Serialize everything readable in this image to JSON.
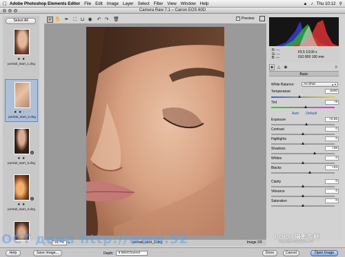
{
  "menubar": {
    "apple": "",
    "app_name": "Adobe Photoshop Elements Editor",
    "items": [
      "File",
      "Edit",
      "Image",
      "Layer",
      "Select",
      "Filter",
      "View",
      "Window",
      "Help"
    ],
    "clock": "Thu 10:12"
  },
  "window": {
    "title": "Camera Raw 7.1  –  Canon EOS 60D"
  },
  "filmstrip": {
    "select_all": "Select All",
    "items": [
      {
        "stars": "★ ★",
        "file": "portrait_start_1.dng",
        "selected": false
      },
      {
        "stars": "★ ★ · · ·",
        "file": "portrait_start_2.dng",
        "selected": true
      },
      {
        "stars": "★ ★",
        "file": "portrait_start_3.dng",
        "selected": false
      },
      {
        "stars": "★ ★",
        "file": "portrait_start_4.dng",
        "selected": false
      }
    ]
  },
  "toolbar": {
    "tools": [
      "zoom-tool",
      "hand-tool",
      "white-balance-tool",
      "crop-tool",
      "straighten-tool",
      "red-eye-tool",
      "rotate-left-tool",
      "rotate-right-tool",
      "trash-tool"
    ],
    "preview_label": "Preview",
    "preview_checked": "✓"
  },
  "status": {
    "zoom": "18.7%",
    "filename": "portrait_start_2.dng",
    "nav": "Image 2/5"
  },
  "readout": {
    "r": "R:",
    "g": "G:",
    "b": "B:",
    "r_val": "---",
    "g_val": "---",
    "b_val": "---",
    "exif_line1": "f/3.5   1/100 s",
    "exif_line2": "ISO 800   100 mm"
  },
  "panel": {
    "section_title": "Basic",
    "white_balance_label": "White Balance:",
    "white_balance_value": "As Shot",
    "temperature": {
      "label": "Temperature",
      "value": "5200",
      "pos": 0.45
    },
    "tint": {
      "label": "Tint",
      "value": "+8",
      "pos": 0.55
    },
    "auto": "Auto",
    "default": "Default",
    "exposure": {
      "label": "Exposure",
      "value": "+0.65",
      "pos": 0.56
    },
    "contrast": {
      "label": "Contrast",
      "value": "0",
      "pos": 0.5
    },
    "highlights": {
      "label": "Highlights",
      "value": "0",
      "pos": 0.5
    },
    "shadows": {
      "label": "Shadows",
      "value": "+38",
      "pos": 0.69
    },
    "whites": {
      "label": "Whites",
      "value": "0",
      "pos": 0.5
    },
    "blacks": {
      "label": "Blacks",
      "value": "+23",
      "pos": 0.61
    },
    "clarity": {
      "label": "Clarity",
      "value": "0",
      "pos": 0.5
    },
    "vibrance": {
      "label": "Vibrance",
      "value": "0",
      "pos": 0.5
    },
    "saturation": {
      "label": "Saturation",
      "value": "0",
      "pos": 0.5
    }
  },
  "bottom": {
    "help": "Help",
    "save": "Save Image...",
    "depth_label": "Depth:",
    "depth_value": "8 Bits/Channel",
    "done": "Done",
    "cancel": "Cancel",
    "open": "Open Image"
  },
  "watermark": {
    "logo": "POCO 摄影专题",
    "url": "http://photo.poco.cn/",
    "band": "OCT дема  http://www.52"
  },
  "colors": {
    "accent": "#4a6fa8",
    "selection": "#aebfd8",
    "link": "#1d48a8"
  }
}
